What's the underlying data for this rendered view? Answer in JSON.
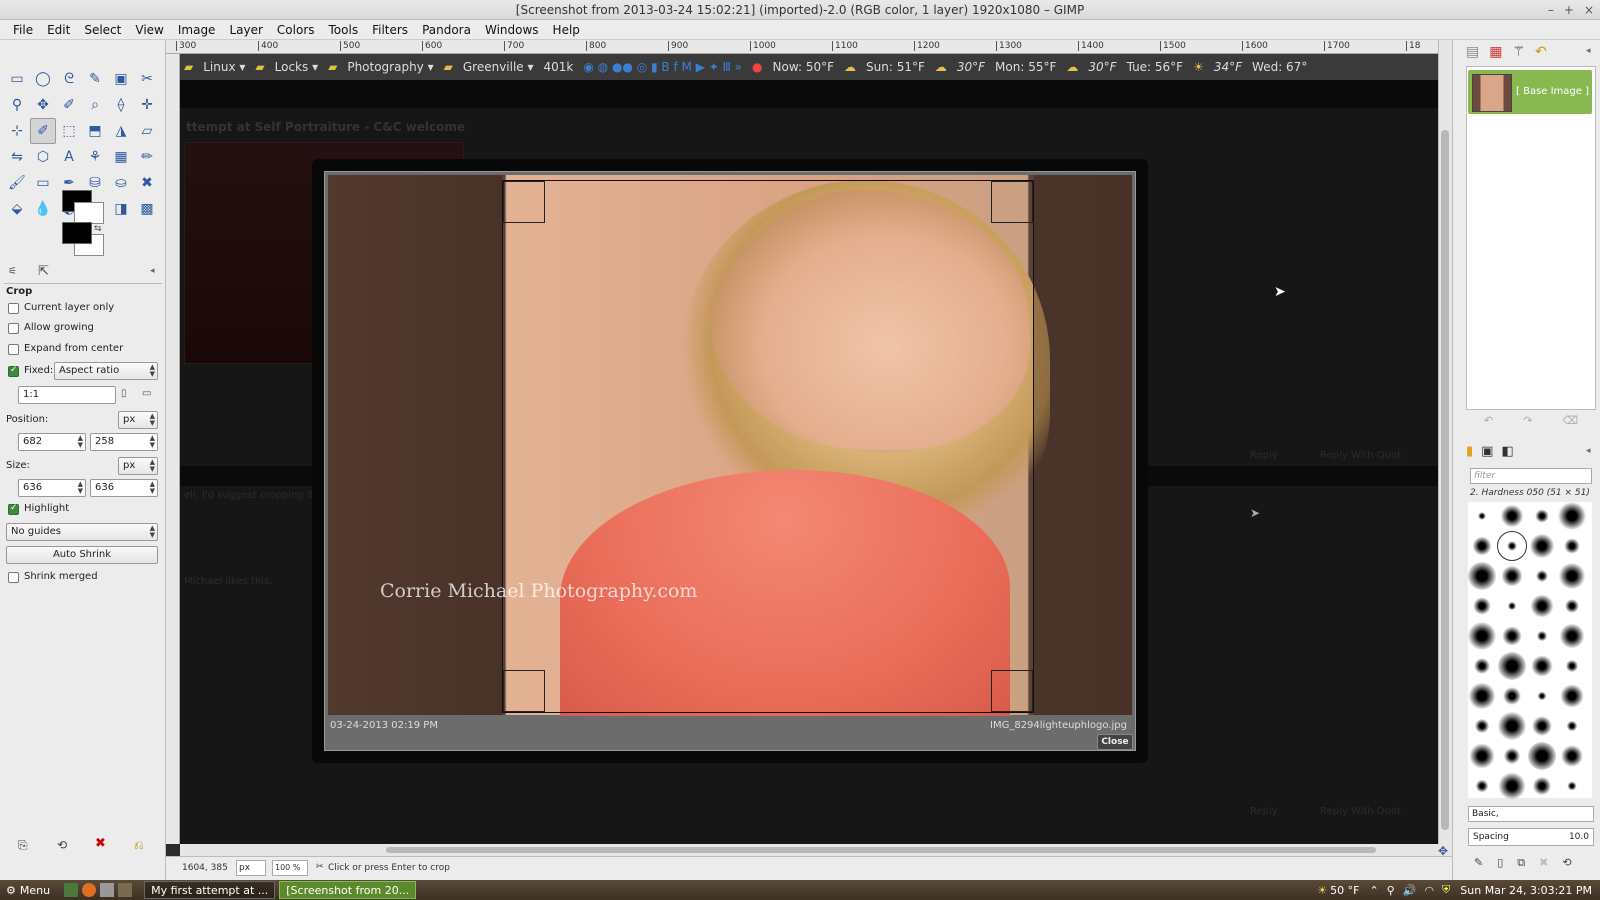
{
  "window": {
    "title": "[Screenshot from 2013-03-24 15:02:21] (imported)-2.0 (RGB color, 1 layer) 1920x1080 – GIMP",
    "controls": [
      "–",
      "+",
      "×"
    ]
  },
  "menubar": [
    "File",
    "Edit",
    "Select",
    "View",
    "Image",
    "Layer",
    "Colors",
    "Tools",
    "Filters",
    "Pandora",
    "Windows",
    "Help"
  ],
  "toolbox": {
    "tools": [
      "▭",
      "◯",
      "ᘓ",
      "✎",
      "▣",
      "✂",
      "⚲",
      "✥",
      "✐",
      "⌕",
      "⟠",
      "✛",
      "⊹",
      "✐",
      "⬚",
      "⬒",
      "◮",
      "▱",
      "⇋",
      "⬡",
      "A",
      "⚘",
      "▦",
      "✏",
      "🖌",
      "▭",
      "✒",
      "⛁",
      "⛀",
      "✖",
      "⬙",
      "💧",
      "◐",
      "●",
      "◨",
      "▩"
    ],
    "selected_tool_index": 13,
    "panel_title": "Crop",
    "options": {
      "current_layer_only": "Current layer only",
      "allow_growing": "Allow growing",
      "expand_from_center": "Expand from center",
      "fixed_label": "Fixed:",
      "fixed_value": "Aspect ratio",
      "ratio": "1:1",
      "position_label": "Position:",
      "position_unit": "px",
      "position_x": "682",
      "position_y": "258",
      "size_label": "Size:",
      "size_unit": "px",
      "size_w": "636",
      "size_h": "636",
      "highlight": "Highlight",
      "guides": "No guides",
      "auto_shrink": "Auto Shrink",
      "shrink_merged": "Shrink merged"
    }
  },
  "ruler": {
    "top_ticks": [
      "300",
      "400",
      "500",
      "600",
      "700",
      "800",
      "900",
      "1000",
      "1100",
      "1200",
      "1300",
      "1400",
      "1500",
      "1600",
      "1700",
      "18"
    ]
  },
  "browser_bar": {
    "folders": [
      "Linux ▾",
      "Locks ▾",
      "Photography ▾",
      "Greenville ▾"
    ],
    "count": "401k",
    "weather": [
      "Now: 50°F",
      "Sun: 51°F",
      "30°F",
      "Mon: 55°F",
      "30°F",
      "Tue: 56°F",
      "34°F",
      "Wed: 67°"
    ]
  },
  "forum": {
    "title": "ttempt at Self Portraiture - C&C welcome",
    "reply": "Reply",
    "reply_quote": "Reply With Quot",
    "comment": "ell, I'd suggest cropping it",
    "likes": "Michael likes this."
  },
  "lightbox": {
    "watermark": "Corrie Michael Photography.com",
    "date": "03-24-2013 02:19 PM",
    "filename": "IMG_8294lighteuphlogo.jpg",
    "close": "Close"
  },
  "statusbar": {
    "coords": "1604, 385",
    "unit": "px",
    "zoom": "100 %",
    "message": "Click or press Enter to crop"
  },
  "layers": {
    "layer_name": "[ Base Image ]"
  },
  "brushes": {
    "filter_placeholder": "filter",
    "selected": "2. Hardness 050 (51 × 51)",
    "set": "Basic,",
    "spacing_label": "Spacing",
    "spacing_value": "10.0"
  },
  "taskbar": {
    "menu": "Menu",
    "tasks": [
      "My first attempt at ...",
      "[Screenshot from 20..."
    ],
    "temp": "50 °F",
    "clock": "Sun Mar 24,  3:03:21 PM"
  }
}
